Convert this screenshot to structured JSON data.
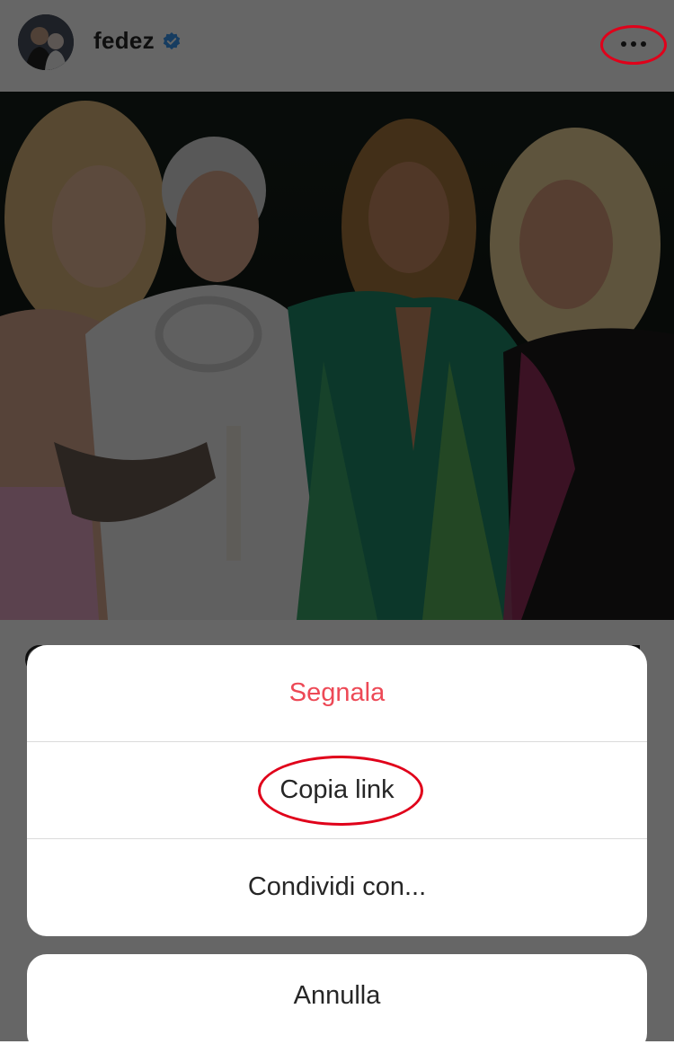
{
  "post": {
    "username": "fedez",
    "verified": true,
    "avatar_icon": "profile-photo",
    "more_icon": "more-horizontal-icon"
  },
  "photo": {
    "description_icon": "post-photo"
  },
  "action_sheet": {
    "items": [
      {
        "label": "Segnala",
        "style": "destructive",
        "color": "#ed4956"
      },
      {
        "label": "Copia link",
        "style": "default",
        "color": "#262626"
      },
      {
        "label": "Condividi con...",
        "style": "default",
        "color": "#262626"
      }
    ],
    "cancel_label": "Annulla"
  },
  "annotations": {
    "color": "#e0001a"
  }
}
